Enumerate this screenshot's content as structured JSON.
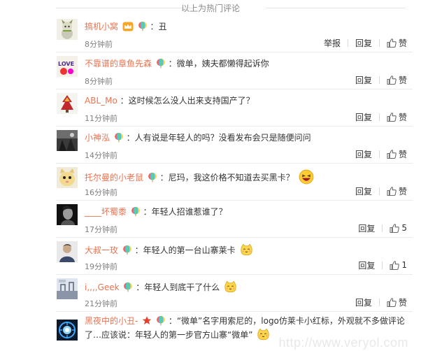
{
  "header_text": "以上为热门评论",
  "comments": [
    {
      "name": "搞机小窝",
      "text": "：丑",
      "time": "8分钟前",
      "report": "举报",
      "reply": "回复",
      "like": "赞"
    },
    {
      "name": "不靠谱的章鱼先森",
      "text": "：微单，姨夫都懒得起诉你",
      "time": "8分钟前",
      "reply": "回复",
      "like": "赞"
    },
    {
      "name": "ABL_Mo",
      "text": "：这时候怎么没人出来支持国产了？",
      "time": "11分钟前",
      "reply": "回复",
      "like": "赞"
    },
    {
      "name": "小神泓",
      "text": "：人有说是年轻人的吗？没看发布会只是随便问问",
      "time": "14分钟前",
      "reply": "回复",
      "like": "赞"
    },
    {
      "name": "托尔曼的小老鼠",
      "text": "：尼玛，我这价格不知道去买黑卡？",
      "time": "16分钟前",
      "reply": "回复",
      "like": "赞"
    },
    {
      "name": "____坏蜀黍",
      "text": "：年轻人招谁惹谁了？",
      "time": "17分钟前",
      "reply": "回复",
      "like": "5"
    },
    {
      "name": "大叔一玫",
      "text": "：年轻人的第一台山寨莱卡",
      "time": "19分钟前",
      "reply": "回复",
      "like": "1"
    },
    {
      "name": "i,,,,Geek",
      "text": "：年轻人到底干了什么",
      "time": "21分钟前",
      "reply": "回复",
      "like": "赞"
    },
    {
      "name": "黑夜中的小丑-",
      "text": "：“微单”名字用索尼的，logo仿莱卡小红标，外观就不多做评论了…应该说：年轻人的第一步官方山寨“微单”"
    }
  ],
  "watermark": "http://www.veryol.com",
  "colors": {
    "name": "#eb7350",
    "text": "#333333",
    "time": "#808080",
    "divider": "#e5e5e5"
  },
  "icons": {
    "thumb": "thumbs-up-icon",
    "badge": "rainbow-balloon-icon",
    "emoji": "laughing-face-icon"
  }
}
